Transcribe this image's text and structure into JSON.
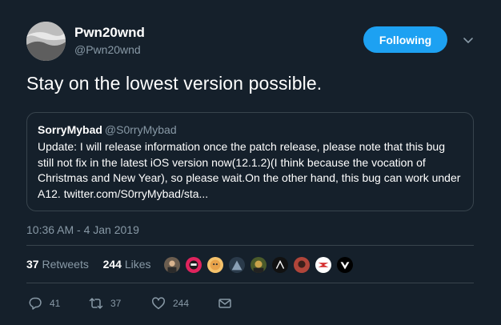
{
  "author": {
    "name": "Pwn20wnd",
    "handle": "@Pwn20wnd"
  },
  "follow_button": {
    "label": "Following"
  },
  "tweet": {
    "text": "Stay on the lowest version possible.",
    "timestamp": "10:36 AM - 4 Jan 2019"
  },
  "quote": {
    "name": "SorryMybad",
    "handle": "@S0rryMybad",
    "text": "Update: I will release information once the patch release, please note that this bug\nstill not fix in the latest iOS version now(12.1.2)(I think because the vocation of\nChristmas and New Year), so please wait.On the other hand, this bug can work under\nA12. twitter.com/S0rryMybad/sta..."
  },
  "stats": {
    "retweets_count": "37",
    "retweets_label": "Retweets",
    "likes_count": "244",
    "likes_label": "Likes"
  },
  "liker_avatars": [
    {
      "color": "#6b5d4f"
    },
    {
      "color": "#e0245e"
    },
    {
      "color": "#e8a24a"
    },
    {
      "color": "#2a3a4a"
    },
    {
      "color": "#4a5a2a"
    },
    {
      "color": "#111111"
    },
    {
      "color": "#b0453a"
    },
    {
      "color": "#ffffff"
    },
    {
      "color": "#000000"
    }
  ],
  "actions": {
    "reply_count": "41",
    "retweet_count": "37",
    "like_count": "244"
  },
  "colors": {
    "background": "#15202b",
    "accent": "#1da1f2",
    "muted": "#8899a6",
    "border": "#38444d"
  }
}
